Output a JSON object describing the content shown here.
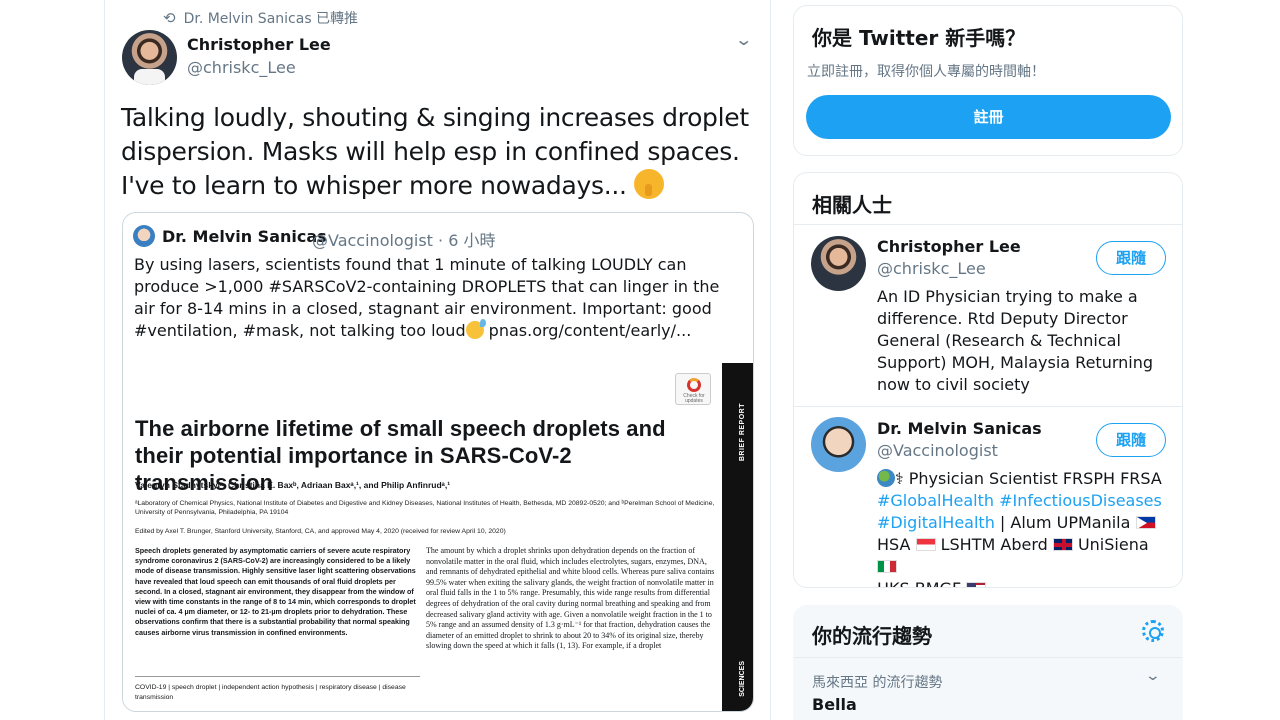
{
  "tweet": {
    "retweeted_by": "Dr. Melvin Sanicas 已轉推",
    "author_name": "Christopher Lee",
    "author_handle": "@chriskc_Lee",
    "text": "Talking loudly, shouting & singing increases droplet dispersion. Masks will help esp in confined spaces. I've to learn to whisper more nowadays...",
    "emoji": "shushing-face"
  },
  "quote": {
    "author_name": "Dr. Melvin Sanicas",
    "author_handle": "@Vaccinologist",
    "time": "· 6 小時",
    "text_1": "By using lasers, scientists found that 1 minute of talking LOUDLY can produce >1,000 #SARSCoV2-containing DROPLETS that can linger in the air for 8-14 mins in a closed, stagnant air environment. Important: good #ventilation, #mask, not talking too loud",
    "text_2": " pnas.org/content/early/...",
    "paper": {
      "band_label": "BRIEF REPORT",
      "band_label_2": "SCIENCES",
      "check_label": "Check for updates",
      "title": "The airborne lifetime of small speech droplets and their potential importance in SARS-CoV-2 transmission",
      "authors": "Valentyn Stadnytskyiᵃ, Christina E. Baxᵇ, Adriaan Baxᵃ,¹, and Philip Anfinrudᵃ,¹",
      "affiliation": "ᵃLaboratory of Chemical Physics, National Institute of Diabetes and Digestive and Kidney Diseases, National Institutes of Health, Bethesda, MD 20892-0520; and ᵇPerelman School of Medicine, University of Pennsylvania, Philadelphia, PA 19104",
      "edited": "Edited by Axel T. Brunger, Stanford University, Stanford, CA, and approved May 4, 2020 (received for review April 10, 2020)",
      "abstract": "Speech droplets generated by asymptomatic carriers of severe acute respiratory syndrome coronavirus 2 (SARS-CoV-2) are increasingly considered to be a likely mode of disease transmission. Highly sensitive laser light scattering observations have revealed that loud speech can emit thousands of oral fluid droplets per second. In a closed, stagnant air environment, they disappear from the window of view with time constants in the range of 8 to 14 min, which corresponds to droplet nuclei of ca. 4 µm diameter, or 12- to 21-µm droplets prior to dehydration. These observations confirm that there is a substantial probability that normal speaking causes airborne virus transmission in confined environments.",
      "keywords": "COVID-19 | speech droplet | independent action hypothesis | respiratory disease | disease transmission",
      "body": "The amount by which a droplet shrinks upon dehydration depends on the fraction of nonvolatile matter in the oral fluid, which includes electrolytes, sugars, enzymes, DNA, and remnants of dehydrated epithelial and white blood cells. Whereas pure saliva contains 99.5% water when exiting the salivary glands, the weight fraction of nonvolatile matter in oral fluid falls in the 1 to 5% range. Presumably, this wide range results from differential degrees of dehydration of the oral cavity during normal breathing and speaking and from decreased salivary gland activity with age. Given a nonvolatile weight fraction in the 1 to 5% range and an assumed density of 1.3 g·mL⁻¹ for that fraction, dehydration causes the diameter of an emitted droplet to shrink to about 20 to 34% of its original size, thereby slowing down the speed at which it falls (1, 13). For example, if a droplet"
    }
  },
  "sidebar": {
    "signup": {
      "title": "你是 Twitter 新手嗎？",
      "subtitle": "立即註冊，取得你個人專屬的時間軸！",
      "button": "註冊"
    },
    "related": {
      "title": "相關人士",
      "people": [
        {
          "name": "Christopher Lee",
          "handle": "@chriskc_Lee",
          "follow": "跟隨",
          "bio": "An ID Physician trying to make a difference. Rtd Deputy Director General (Research & Technical Support) MOH, Malaysia Returning now to civil society"
        },
        {
          "name": "Dr. Melvin Sanicas",
          "handle": "@Vaccinologist",
          "follow": "跟隨",
          "bio_1": " Physician Scientist FRSPH FRSA",
          "bio_tags": "#GlobalHealth #InfectiousDiseases",
          "bio_tag2": "#DigitalHealth",
          "bio_2": " | Alum UPManila ",
          "bio_3": "HSA ",
          "bio_4": " LSHTM Aberd ",
          "bio_5": " UniSiena ",
          "bio_6": "HKS BMGF "
        }
      ]
    },
    "trends": {
      "title": "你的流行趨勢",
      "context": "馬來西亞 的流行趨勢",
      "first_trend": "Bella"
    }
  },
  "colors": {
    "accent": "#1da1f2",
    "muted": "#657786",
    "text": "#14171a"
  }
}
